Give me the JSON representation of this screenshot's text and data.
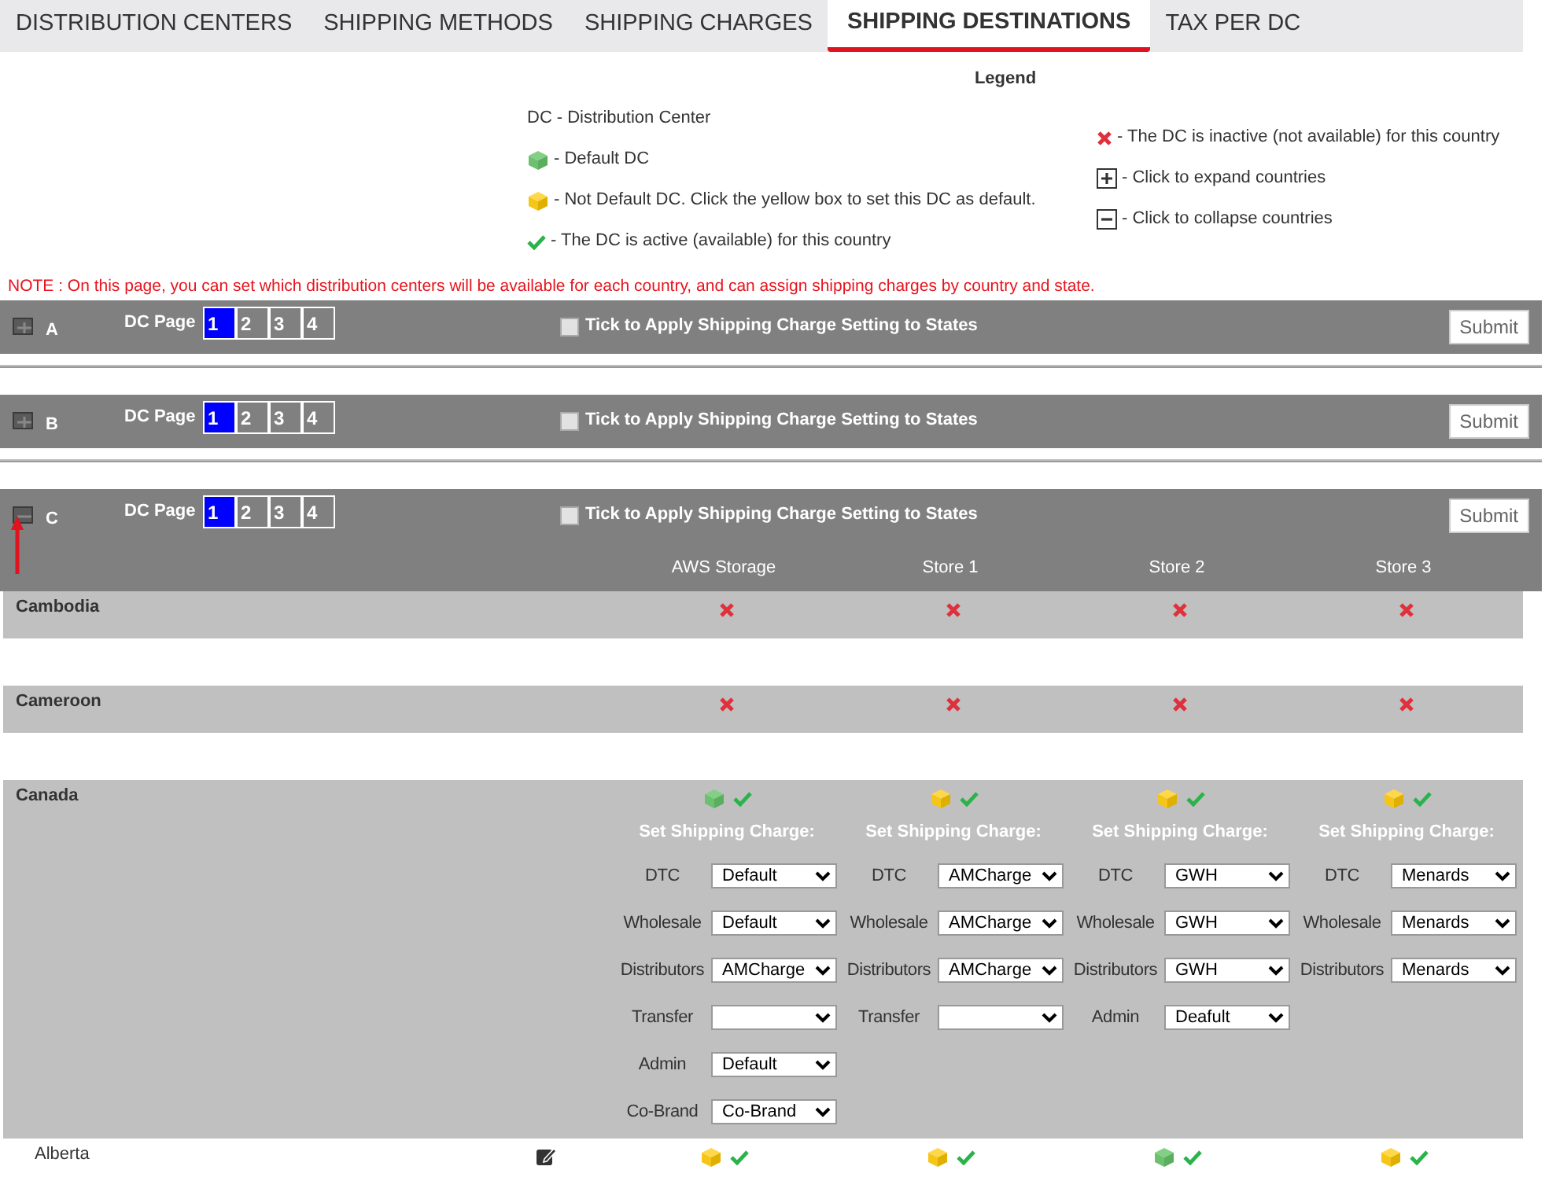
{
  "tabs": [
    {
      "label": "DISTRIBUTION CENTERS",
      "selected": false
    },
    {
      "label": "SHIPPING METHODS",
      "selected": false
    },
    {
      "label": "SHIPPING CHARGES",
      "selected": false
    },
    {
      "label": "SHIPPING DESTINATIONS",
      "selected": true
    },
    {
      "label": "TAX PER DC",
      "selected": false
    }
  ],
  "legend": {
    "title": "Legend",
    "left": [
      {
        "kind": "abbrev",
        "key": "DC",
        "text": "- Distribution Center"
      },
      {
        "kind": "default",
        "text": "- Default DC"
      },
      {
        "kind": "notdefault",
        "text": "- Not Default DC. Click the yellow box to set this DC as default."
      },
      {
        "kind": "active",
        "text": "- The DC is active (available) for this country"
      }
    ],
    "right": [
      {
        "kind": "inactive",
        "text": "- The DC is inactive (not available) for this country"
      },
      {
        "kind": "expand",
        "text": "- Click to expand countries"
      },
      {
        "kind": "collapse",
        "text": "- Click to collapse countries"
      }
    ]
  },
  "note": "NOTE : On this page, you can set which distribution centers will be available for each country, and can assign shipping charges by country and state.",
  "dc_groups": [
    {
      "letter": "A",
      "expanded": false,
      "page_label": "DC Page",
      "pages": [
        {
          "label": "1",
          "selected": true
        },
        {
          "label": "2",
          "selected": false
        },
        {
          "label": "3",
          "selected": false
        },
        {
          "label": "4",
          "selected": false
        }
      ],
      "apply_label": "Tick to Apply Shipping Charge Setting to States",
      "apply_checked": false,
      "submit": "Submit"
    },
    {
      "letter": "B",
      "expanded": false,
      "page_label": "DC Page",
      "pages": [
        {
          "label": "1",
          "selected": true
        },
        {
          "label": "2",
          "selected": false
        },
        {
          "label": "3",
          "selected": false
        },
        {
          "label": "4",
          "selected": false
        }
      ],
      "apply_label": "Tick to Apply Shipping Charge Setting to States",
      "apply_checked": false,
      "submit": "Submit"
    },
    {
      "letter": "C",
      "expanded": true,
      "page_label": "DC Page",
      "pages": [
        {
          "label": "1",
          "selected": true
        },
        {
          "label": "2",
          "selected": false
        },
        {
          "label": "3",
          "selected": false
        },
        {
          "label": "4",
          "selected": false
        }
      ],
      "apply_label": "Tick to Apply Shipping Charge Setting to States",
      "apply_checked": false,
      "submit": "Submit",
      "columns": [
        "AWS Storage",
        "Store 1",
        "Store 2",
        "Store 3"
      ],
      "countries": [
        {
          "name": "Cambodia",
          "cells": [
            {
              "active": false
            },
            {
              "active": false
            },
            {
              "active": false
            },
            {
              "active": false
            }
          ]
        },
        {
          "name": "Cameroon",
          "cells": [
            {
              "active": false
            },
            {
              "active": false
            },
            {
              "active": false
            },
            {
              "active": false
            }
          ]
        },
        {
          "name": "Canada",
          "cells": [
            {
              "active": true,
              "default": true,
              "charge_title": "Set Shipping Charge:",
              "fields": [
                {
                  "label": "DTC",
                  "value": "Default"
                },
                {
                  "label": "Wholesale",
                  "value": "Default"
                },
                {
                  "label": "Distributors",
                  "value": "AMCharge"
                },
                {
                  "label": "Transfer"
                },
                {
                  "label": "Admin",
                  "value": "Default"
                },
                {
                  "label": "Co-Brand",
                  "value": "Co-Brand"
                }
              ]
            },
            {
              "active": true,
              "default": false,
              "charge_title": "Set Shipping Charge:",
              "fields": [
                {
                  "label": "DTC",
                  "value": "AMCharge"
                },
                {
                  "label": "Wholesale",
                  "value": "AMCharge"
                },
                {
                  "label": "Distributors",
                  "value": "AMCharge"
                },
                {
                  "label": "Transfer"
                }
              ]
            },
            {
              "active": true,
              "default": false,
              "charge_title": "Set Shipping Charge:",
              "fields": [
                {
                  "label": "DTC",
                  "value": "GWH"
                },
                {
                  "label": "Wholesale",
                  "value": "GWH"
                },
                {
                  "label": "Distributors",
                  "value": "GWH"
                },
                {
                  "label": "Admin",
                  "value": "Deafult"
                }
              ]
            },
            {
              "active": true,
              "default": false,
              "charge_title": "Set Shipping Charge:",
              "fields": [
                {
                  "label": "DTC",
                  "value": "Menards"
                },
                {
                  "label": "Wholesale",
                  "value": "Menards"
                },
                {
                  "label": "Distributors",
                  "value": "Menards"
                }
              ]
            }
          ],
          "states": [
            {
              "name": "Alberta",
              "cells": [
                {
                  "active": true,
                  "default": false
                },
                {
                  "active": true,
                  "default": false
                },
                {
                  "active": true,
                  "default": true
                },
                {
                  "active": true,
                  "default": false
                }
              ]
            }
          ]
        }
      ]
    }
  ]
}
